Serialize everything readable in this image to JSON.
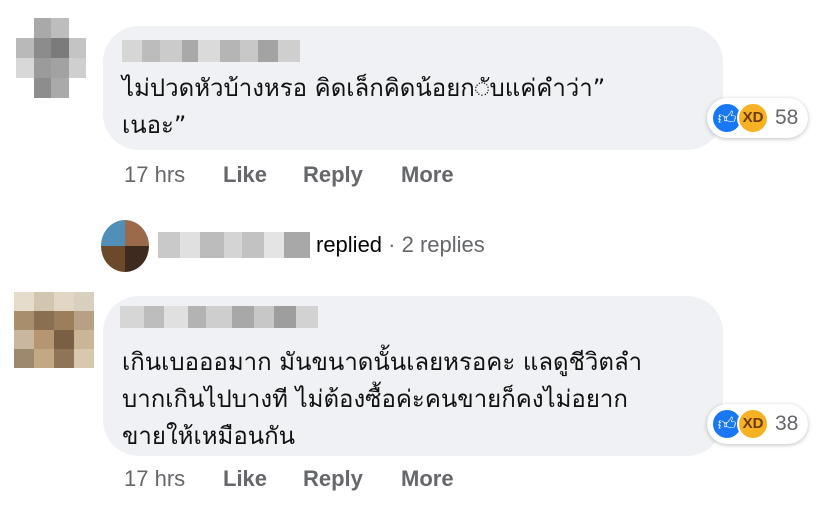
{
  "comments": [
    {
      "text": "ไม่ปวดหัวบ้างหรอ คิดเล็กคิดน้อยก◌ับแค่คำว่า”\nเนอะ”",
      "reaction_count": "58",
      "time": "17 hrs",
      "like_label": "Like",
      "reply_label": "Reply",
      "more_label": "More"
    },
    {
      "text": "เกินเบอออมาก มันขนาดนั้นเลยหรอคะ แลดูชีวิตลำ\nบากเกินไปบางที ไม่ต้องซื้อค่ะคนขายก็คงไม่อยาก\nขายให้เหมือนกัน",
      "reaction_count": "38",
      "time": "17 hrs",
      "like_label": "Like",
      "reply_label": "Reply",
      "more_label": "More"
    }
  ],
  "replies_row": {
    "replied_label": "replied",
    "separator": "·",
    "replies_label": "2 replies"
  },
  "colors": {
    "bubble": "#eff1f4",
    "meta_text": "#65676b",
    "like_blue": "#1877f2",
    "haha_yellow": "#f7b125"
  },
  "icons": [
    "like-reaction-icon",
    "haha-reaction-icon"
  ]
}
